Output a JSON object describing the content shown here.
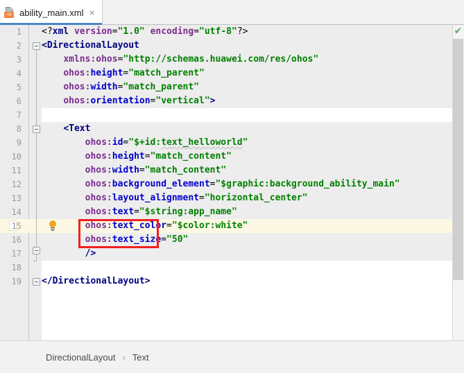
{
  "tab": {
    "title": "ability_main.xml",
    "file_icon": "xml-file-icon",
    "badge_text": "<>",
    "close_label": "×"
  },
  "editor": {
    "inspection_status_icon": "green-checkmark-icon",
    "gutter_icon": "lightbulb-intention-icon",
    "highlighted_line": 15,
    "line_numbers": [
      1,
      2,
      3,
      4,
      5,
      6,
      7,
      8,
      9,
      10,
      11,
      12,
      13,
      14,
      15,
      16,
      17,
      18,
      19
    ],
    "lines": [
      {
        "num": 1,
        "text": "<?xml version=\"1.0\" encoding=\"utf-8\"?>"
      },
      {
        "num": 2,
        "text": "<DirectionalLayout"
      },
      {
        "num": 3,
        "text": "    xmlns:ohos=\"http://schemas.huawei.com/res/ohos\""
      },
      {
        "num": 4,
        "text": "    ohos:height=\"match_parent\""
      },
      {
        "num": 5,
        "text": "    ohos:width=\"match_parent\""
      },
      {
        "num": 6,
        "text": "    ohos:orientation=\"vertical\">"
      },
      {
        "num": 7,
        "text": ""
      },
      {
        "num": 8,
        "text": "    <Text"
      },
      {
        "num": 9,
        "text": "        ohos:id=\"$+id:text_helloworld\""
      },
      {
        "num": 10,
        "text": "        ohos:height=\"match_content\""
      },
      {
        "num": 11,
        "text": "        ohos:width=\"match_content\""
      },
      {
        "num": 12,
        "text": "        ohos:background_element=\"$graphic:background_ability_main\""
      },
      {
        "num": 13,
        "text": "        ohos:layout_alignment=\"horizontal_center\""
      },
      {
        "num": 14,
        "text": "        ohos:text=\"$string:app_name\""
      },
      {
        "num": 15,
        "text": "        ohos:text_color=\"$color:white\""
      },
      {
        "num": 16,
        "text": "        ohos:text_size=\"50\""
      },
      {
        "num": 17,
        "text": "        />"
      },
      {
        "num": 18,
        "text": ""
      },
      {
        "num": 19,
        "text": "</DirectionalLayout>"
      }
    ],
    "annotation": {
      "type": "red-rectangle-highlight",
      "covers_lines": "15-16",
      "color": "#f02020"
    }
  },
  "breadcrumb": {
    "items": [
      "DirectionalLayout",
      "Text"
    ],
    "separator": "›"
  },
  "colors": {
    "tab_active_underline": "#4a86c8",
    "code_band": "#ededed",
    "line_highlight": "#fcf8e3",
    "annotation_red": "#f02020",
    "inspection_green": "#59a869",
    "xml_tag": "#000080",
    "xml_attr": "#7a2b8f",
    "xml_value": "#008000"
  }
}
